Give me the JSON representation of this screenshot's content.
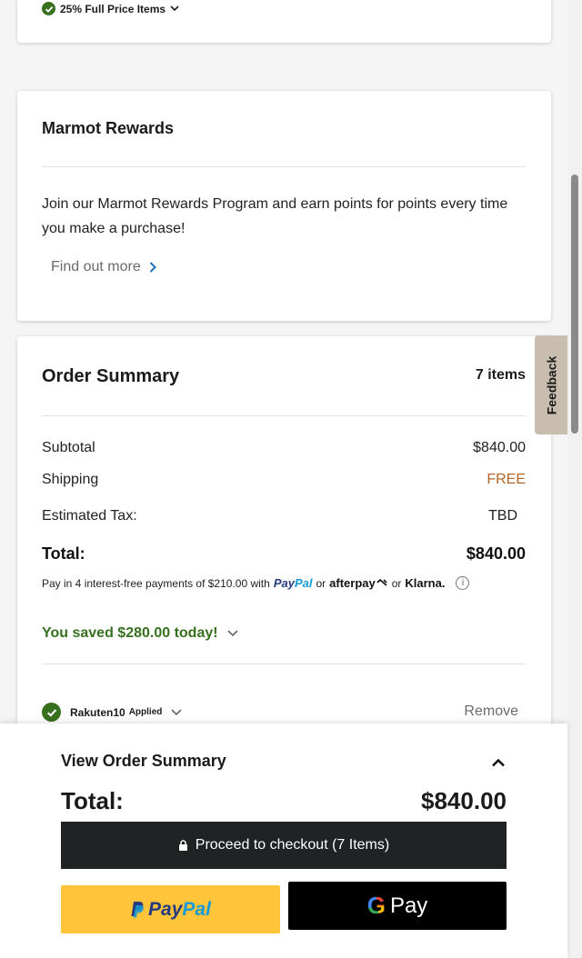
{
  "promo": {
    "label": "25% Full Price Items"
  },
  "rewards": {
    "title": "Marmot Rewards",
    "description": "Join our Marmot Rewards Program and earn points for points every time you make a purchase!",
    "link": "Find out more"
  },
  "summary": {
    "title": "Order Summary",
    "item_count": "7 items",
    "subtotal_label": "Subtotal",
    "subtotal_value": "$840.00",
    "shipping_label": "Shipping",
    "shipping_value": "FREE",
    "tax_label": "Estimated Tax:",
    "tax_value": "TBD",
    "total_label": "Total:",
    "total_value": "$840.00",
    "payin_text": "Pay in 4 interest-free payments of $210.00 with",
    "paypal_pay": "Pay",
    "paypal_pal": "Pal",
    "or1": "or",
    "afterpay": "afterpay",
    "or2": "or",
    "klarna": "Klarna.",
    "info": "i",
    "saved": "You saved $280.00 today!",
    "coupon_code": "Rakuten10",
    "coupon_status": "Applied",
    "remove": "Remove"
  },
  "feedback": "Feedback",
  "sticky": {
    "view_summary": "View Order Summary",
    "total_label": "Total:",
    "total_value": "$840.00",
    "checkout": "Proceed to checkout (7 Items)",
    "paypal_pay": "Pay",
    "paypal_pal": "Pal",
    "gpay_g": "G",
    "gpay_pay": "Pay"
  },
  "colors": {
    "success_green": "#37701f",
    "free_orange": "#b3652a",
    "checkout_bg": "#1f2324",
    "paypal_yellow": "#ffc439",
    "feedback_tab": "#c9bdb0"
  },
  "icons": [
    "check-icon",
    "chevron-down-icon",
    "chevron-right-icon",
    "chevron-up-icon",
    "lock-icon",
    "info-icon",
    "paypal-logo-icon",
    "google-g-icon"
  ]
}
